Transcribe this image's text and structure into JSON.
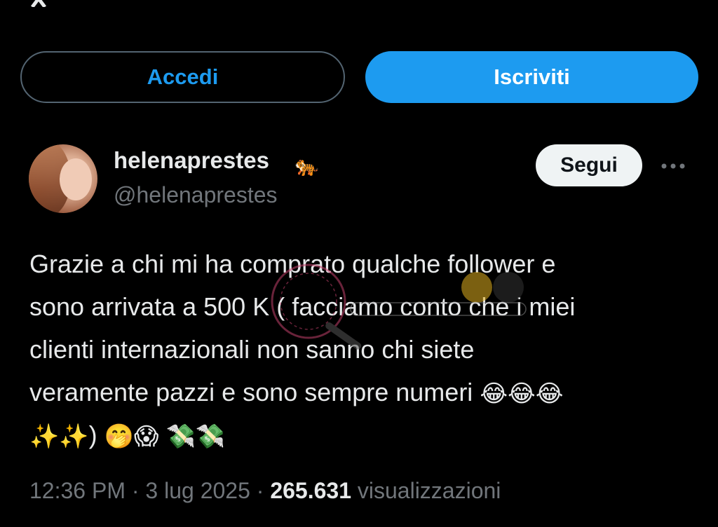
{
  "header": {
    "logo_icon": "x-logo-icon"
  },
  "auth": {
    "login_label": "Accedi",
    "signup_label": "Iscriviti"
  },
  "post": {
    "display_name": "helenaprestes",
    "badge_emoji": "🐅",
    "handle": "@helenaprestes",
    "follow_label": "Segui",
    "more_icon": "more-dots-icon",
    "text_lines": [
      "Grazie a chi mi ha comprato qualche follower e",
      "sono arrivata a 500 K ( facciamo conto che i miei",
      "clienti internazionali non sanno chi siete",
      "veramente pazzi e sono sempre numeri"
    ],
    "emoji_line4": "😂😂😂",
    "emoji_line5_a": "✨✨",
    "paren": ")",
    "emoji_line5_b": "🤭😱",
    "emoji_line5_c": "💸💸",
    "time": "12:36 PM",
    "sep1": "·",
    "date": "3 lug 2025",
    "sep2": "·",
    "views_count": "265.631",
    "views_label": "visualizzazioni"
  },
  "colors": {
    "background": "#000000",
    "accent": "#1d9bf0",
    "text": "#e7e9ea",
    "muted": "#71767b"
  }
}
